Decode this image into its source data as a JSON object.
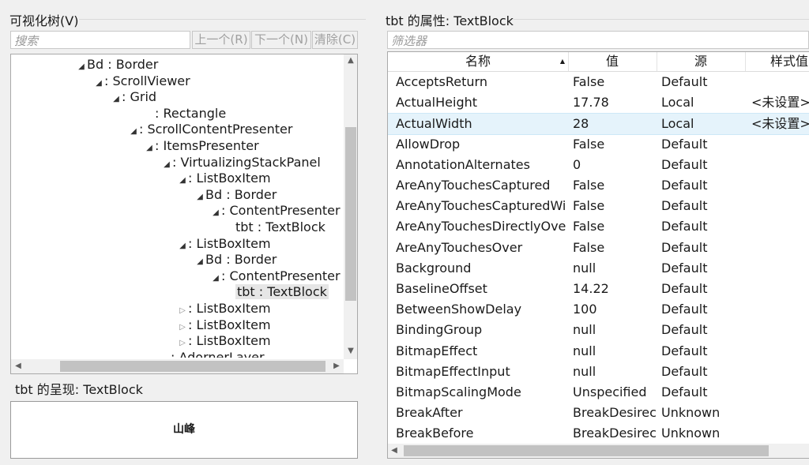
{
  "visual_tree": {
    "title": "可视化树(V)",
    "search_placeholder": "搜索",
    "prev_button": "上一个(R)",
    "next_button": "下一个(N)",
    "clear_button": "清除(C)",
    "nodes": [
      {
        "text": "Bd : Border",
        "toggle": "open"
      },
      {
        "text": ": ScrollViewer",
        "toggle": "open"
      },
      {
        "text": ": Grid",
        "toggle": "open"
      },
      {
        "text": ": Rectangle",
        "toggle": "none"
      },
      {
        "text": ": ScrollContentPresenter",
        "toggle": "open"
      },
      {
        "text": ": ItemsPresenter",
        "toggle": "open"
      },
      {
        "text": ": VirtualizingStackPanel",
        "toggle": "open"
      },
      {
        "text": ": ListBoxItem",
        "toggle": "open"
      },
      {
        "text": "Bd : Border",
        "toggle": "open"
      },
      {
        "text": ": ContentPresenter",
        "toggle": "open"
      },
      {
        "text": "tbt : TextBlock",
        "toggle": "none"
      },
      {
        "text": ": ListBoxItem",
        "toggle": "open"
      },
      {
        "text": "Bd : Border",
        "toggle": "open"
      },
      {
        "text": ": ContentPresenter",
        "toggle": "open"
      },
      {
        "text": "tbt : TextBlock",
        "toggle": "none",
        "selected": true
      },
      {
        "text": ": ListBoxItem",
        "toggle": "closed"
      },
      {
        "text": ": ListBoxItem",
        "toggle": "closed"
      },
      {
        "text": ": ListBoxItem",
        "toggle": "closed"
      },
      {
        "text": ": AdornerLayer",
        "toggle": "none"
      }
    ]
  },
  "rendering": {
    "title": "tbt 的呈现: TextBlock",
    "preview_text": "山峰"
  },
  "properties": {
    "title": "tbt 的属性: TextBlock",
    "filter_placeholder": "筛选器",
    "columns": [
      "名称",
      "值",
      "源",
      "样式值"
    ],
    "sort_indicator": "▲",
    "rows": [
      {
        "name": "AcceptsReturn",
        "value": "False",
        "source": "Default",
        "style": ""
      },
      {
        "name": "ActualHeight",
        "value": "17.78",
        "source": "Local",
        "style": "<未设置>"
      },
      {
        "name": "ActualWidth",
        "value": "28",
        "source": "Local",
        "style": "<未设置>"
      },
      {
        "name": "AllowDrop",
        "value": "False",
        "source": "Default",
        "style": ""
      },
      {
        "name": "AnnotationAlternates",
        "value": "0",
        "source": "Default",
        "style": ""
      },
      {
        "name": "AreAnyTouchesCaptured",
        "value": "False",
        "source": "Default",
        "style": ""
      },
      {
        "name": "AreAnyTouchesCapturedWi",
        "value": "False",
        "source": "Default",
        "style": ""
      },
      {
        "name": "AreAnyTouchesDirectlyOve",
        "value": "False",
        "source": "Default",
        "style": ""
      },
      {
        "name": "AreAnyTouchesOver",
        "value": "False",
        "source": "Default",
        "style": ""
      },
      {
        "name": "Background",
        "value": "null",
        "source": "Default",
        "style": ""
      },
      {
        "name": "BaselineOffset",
        "value": "14.22",
        "source": "Default",
        "style": ""
      },
      {
        "name": "BetweenShowDelay",
        "value": "100",
        "source": "Default",
        "style": ""
      },
      {
        "name": "BindingGroup",
        "value": "null",
        "source": "Default",
        "style": ""
      },
      {
        "name": "BitmapEffect",
        "value": "null",
        "source": "Default",
        "style": ""
      },
      {
        "name": "BitmapEffectInput",
        "value": "null",
        "source": "Default",
        "style": ""
      },
      {
        "name": "BitmapScalingMode",
        "value": "Unspecified",
        "source": "Default",
        "style": ""
      },
      {
        "name": "BreakAfter",
        "value": "BreakDesirec",
        "source": "Unknown",
        "style": ""
      },
      {
        "name": "BreakBefore",
        "value": "BreakDesirec",
        "source": "Unknown",
        "style": ""
      }
    ],
    "highlighted_row": 2
  },
  "colors": {
    "row_highlight": "#e5f3fb",
    "selected_node": "#e6e6e6"
  }
}
